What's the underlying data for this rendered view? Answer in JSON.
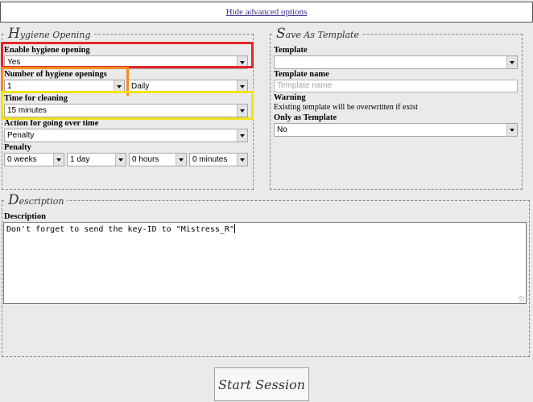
{
  "top": {
    "advanced_link": "Hide advanced options"
  },
  "hygiene": {
    "legend_initial": "H",
    "legend_rest": "ygiene Opening",
    "enable_label": "Enable hygiene opening",
    "enable_value": "Yes",
    "number_label": "Number of hygiene openings",
    "number_value": "1",
    "period_value": "Daily",
    "cleaning_label": "Time for cleaning",
    "cleaning_value": "15 minutes",
    "overtime_label": "Action for going over time",
    "overtime_value": "Penalty",
    "penalty_label": "Penalty",
    "penalty_weeks": "0 weeks",
    "penalty_days": "1 day",
    "penalty_hours": "0 hours",
    "penalty_minutes": "0 minutes"
  },
  "template": {
    "legend_initial": "S",
    "legend_rest": "ave As Template",
    "template_label": "Template",
    "template_value": "",
    "name_label": "Template name",
    "name_placeholder": "Template name",
    "warning_label": "Warning",
    "warning_text": "Existing template will be overwritten if exist",
    "only_label": "Only as Template",
    "only_value": "No"
  },
  "description": {
    "legend_initial": "D",
    "legend_rest": "escription",
    "label": "Description",
    "value": "Don't forget to send the key-ID to \"Mistress_R\""
  },
  "start_button": "Start Session",
  "highlight_colors": {
    "red": "#e3262b",
    "orange": "#f28c1f",
    "yellow": "#f2e21a"
  }
}
